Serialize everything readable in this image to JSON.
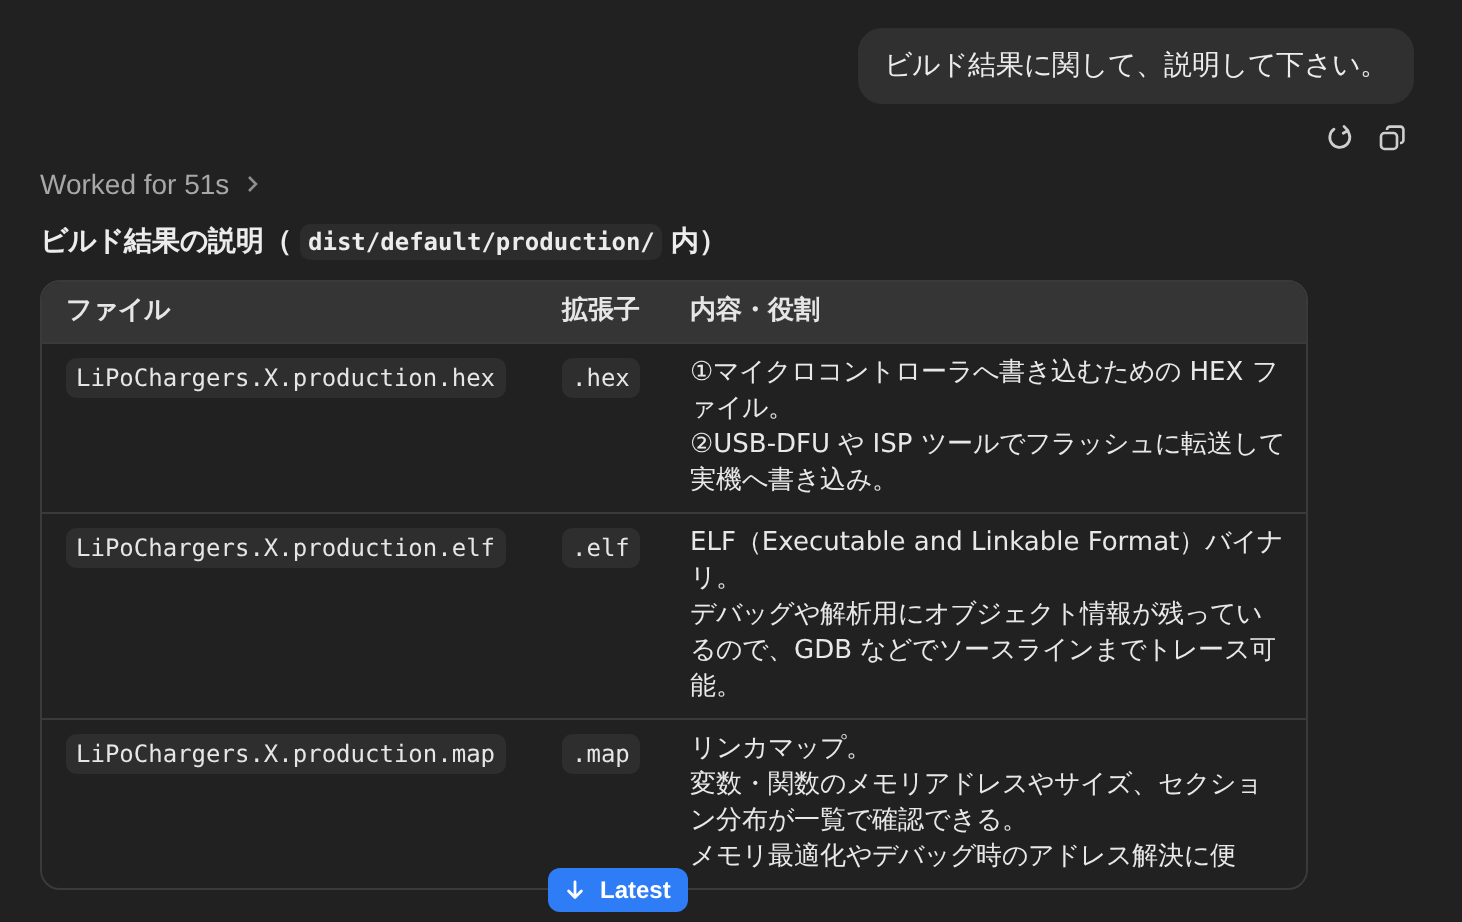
{
  "user_message": "ビルド結果に関して、説明して下さい。",
  "worked_for": "Worked for 51s",
  "heading": {
    "before": "ビルド結果の説明（",
    "code": "dist/default/production/",
    "after": "内）"
  },
  "table": {
    "columns": [
      "ファイル",
      "拡張子",
      "内容・役割"
    ],
    "rows": [
      {
        "file": "LiPoChargers.X.production.hex",
        "ext": ".hex",
        "description": [
          "①マイクロコントローラへ書き込むための HEX ファイル。",
          "②USB-DFU や ISP ツールでフラッシュに転送して実機へ書き込み。"
        ]
      },
      {
        "file": "LiPoChargers.X.production.elf",
        "ext": ".elf",
        "description": [
          "ELF（Executable and Linkable Format）バイナリ。",
          "デバッグや解析用にオブジェクト情報が残っているので、GDB などでソースラインまでトレース可能。"
        ]
      },
      {
        "file": "LiPoChargers.X.production.map",
        "ext": ".map",
        "description": [
          "リンカマップ。",
          "変数・関数のメモリアドレスやサイズ、セクション分布が一覧で確認できる。",
          "メモリ最適化やデバッグ時のアドレス解決に便"
        ]
      }
    ]
  },
  "latest_button": "Latest"
}
